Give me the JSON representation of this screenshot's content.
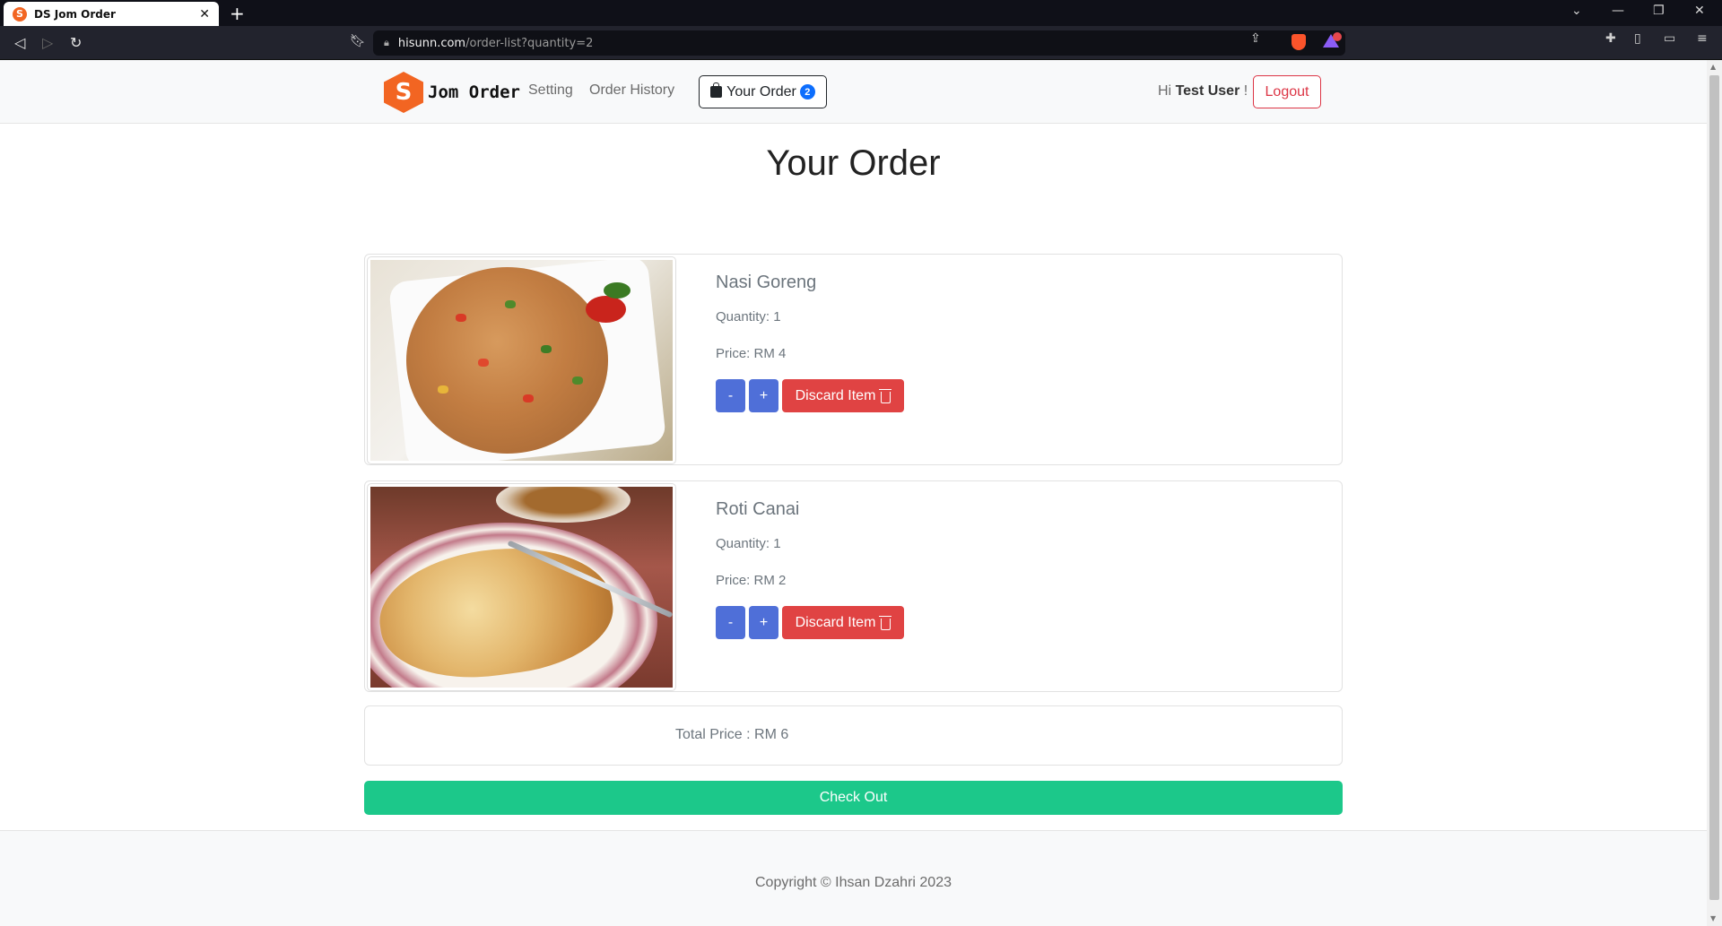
{
  "browser": {
    "tab_title": "DS Jom Order",
    "tab_favicon": "S",
    "url_host": "hisunn.com",
    "url_path": "/order-list?quantity=2"
  },
  "navbar": {
    "brand_letter": "S",
    "brand_name": "Jom Order",
    "links": [
      "Setting",
      "Order History"
    ],
    "order_button_label": "Your Order",
    "order_count": "2",
    "greeting_prefix": "Hi",
    "user_name": "Test User",
    "greeting_suffix": "!",
    "logout_label": "Logout"
  },
  "page": {
    "title": "Your Order"
  },
  "items": [
    {
      "name": "Nasi Goreng",
      "quantity_label": "Quantity:",
      "quantity": "1",
      "price_label": "Price: RM",
      "price": "4",
      "minus_label": "-",
      "plus_label": "+",
      "discard_label": "Discard Item"
    },
    {
      "name": "Roti Canai",
      "quantity_label": "Quantity:",
      "quantity": "1",
      "price_label": "Price: RM",
      "price": "2",
      "minus_label": "-",
      "plus_label": "+",
      "discard_label": "Discard Item"
    }
  ],
  "total": {
    "label": "Total Price : RM",
    "value": "6"
  },
  "checkout_label": "Check Out",
  "footer": {
    "copyright": "Copyright © Ihsan Dzahri 2023"
  },
  "colors": {
    "brand": "#f26522",
    "primary": "#4f6fd8",
    "danger": "#e04343",
    "success": "#1cc88a"
  }
}
